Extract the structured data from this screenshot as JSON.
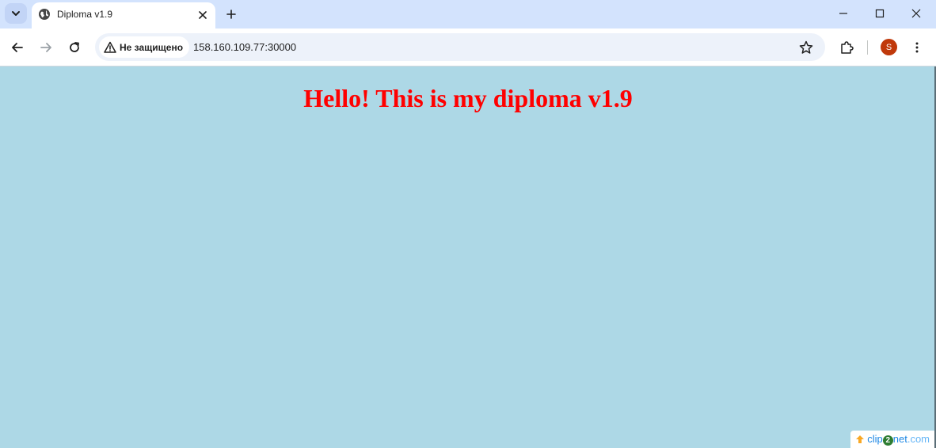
{
  "browser": {
    "tab": {
      "title": "Diploma v1.9"
    },
    "toolbar": {
      "security_label": "Не защищено",
      "url": "158.160.109.77:30000",
      "profile_initial": "S"
    }
  },
  "page": {
    "heading": "Hello! This is my diploma v1.9",
    "background_color": "#add8e6",
    "heading_color": "#ff0000"
  },
  "watermark": {
    "part1": "clip",
    "part2": "2",
    "part3": "net",
    "part4": ".com"
  },
  "icons": {
    "tab_search": "chevron-down-icon",
    "favicon": "globe-icon",
    "tab_close": "close-icon",
    "new_tab": "plus-icon",
    "minimize": "minimize-icon",
    "maximize": "maximize-icon",
    "window_close": "close-icon",
    "back": "arrow-left-icon",
    "forward": "arrow-right-icon",
    "reload": "reload-icon",
    "warning": "warning-icon",
    "bookmark": "star-icon",
    "extensions": "puzzle-icon",
    "menu": "kebab-menu-icon"
  }
}
